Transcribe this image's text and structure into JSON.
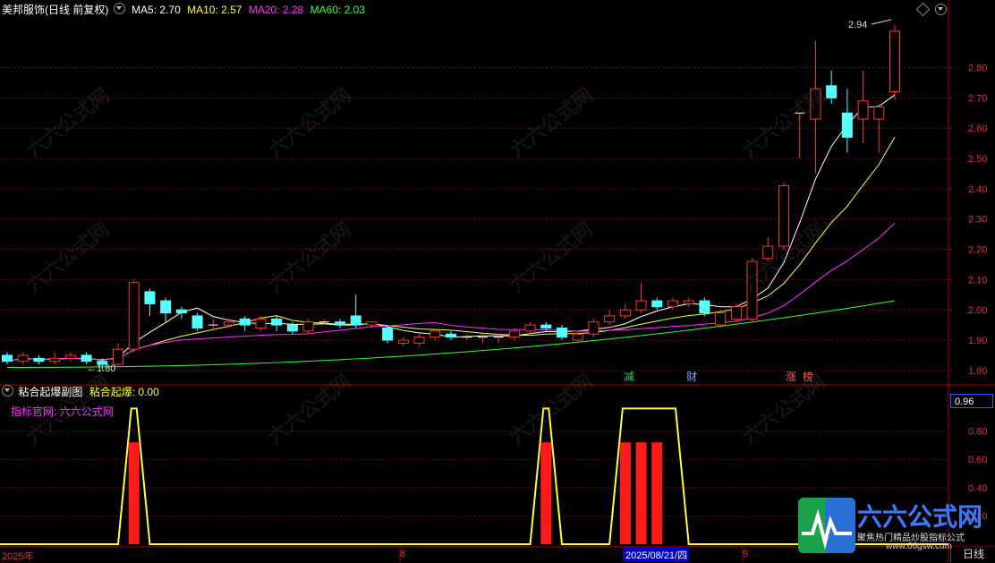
{
  "main_header": {
    "stock_name": "美邦服饰",
    "period": "(日线 前复权)",
    "ma5": {
      "label": "MA5:",
      "value": "2.70",
      "color": "#ffffff"
    },
    "ma10": {
      "label": "MA10:",
      "value": "2.57",
      "color": "#ffff33"
    },
    "ma20": {
      "label": "MA20:",
      "value": "2.28",
      "color": "#ff33ff"
    },
    "ma60": {
      "label": "MA60:",
      "value": "2.03",
      "color": "#33ff33"
    }
  },
  "sub_header": {
    "indicator": "粘合起爆副图",
    "series_label": "粘合起爆:",
    "series_value": "0.00",
    "site_label": "指标官网:",
    "site_value": "六六公式网"
  },
  "price_axis": [
    "2.80",
    "2.70",
    "2.60",
    "2.50",
    "2.40",
    "2.30",
    "2.20",
    "2.10",
    "2.00",
    "1.90",
    "1.80"
  ],
  "sub_axis": [
    "0.96",
    "0.80",
    "0.60",
    "0.40",
    "0.20"
  ],
  "annotations": {
    "high": "2.94",
    "low": "1.80"
  },
  "event_tags": [
    {
      "text": "减",
      "color": "#33cc66"
    },
    {
      "text": "财",
      "color": "#66aaff"
    },
    {
      "text": "涨",
      "color": "#ff5555"
    },
    {
      "text": "榜",
      "color": "#ff5555"
    }
  ],
  "date_axis": {
    "year": "2025年",
    "month8": "8",
    "cursor_date": "2025/08/21/四",
    "month9": "9",
    "period_button": "日线"
  },
  "watermark": {
    "text": "六六公式网",
    "slogan": "聚焦热门精品炒股指标公式",
    "url": "www.66gsw.com"
  },
  "chart_data": {
    "type": "candlestick",
    "ylim": [
      1.77,
      2.97
    ],
    "candles": [
      [
        1.85,
        1.83,
        1.86,
        1.82
      ],
      [
        1.83,
        1.85,
        1.86,
        1.82
      ],
      [
        1.84,
        1.83,
        1.85,
        1.82
      ],
      [
        1.83,
        1.84,
        1.86,
        1.82
      ],
      [
        1.84,
        1.85,
        1.86,
        1.83
      ],
      [
        1.85,
        1.83,
        1.86,
        1.82
      ],
      [
        1.83,
        1.82,
        1.84,
        1.8
      ],
      [
        1.82,
        1.87,
        1.89,
        1.81
      ],
      [
        1.87,
        2.09,
        2.1,
        1.86
      ],
      [
        2.06,
        2.02,
        2.07,
        1.98
      ],
      [
        2.03,
        1.99,
        2.04,
        1.96
      ],
      [
        2.0,
        1.99,
        2.01,
        1.97
      ],
      [
        1.98,
        1.94,
        1.99,
        1.93
      ],
      [
        1.95,
        1.95,
        1.97,
        1.93
      ],
      [
        1.95,
        1.96,
        1.97,
        1.94
      ],
      [
        1.97,
        1.95,
        1.98,
        1.93
      ],
      [
        1.94,
        1.97,
        1.98,
        1.93
      ],
      [
        1.97,
        1.95,
        1.98,
        1.93
      ],
      [
        1.95,
        1.93,
        1.96,
        1.92
      ],
      [
        1.93,
        1.96,
        1.97,
        1.92
      ],
      [
        1.96,
        1.96,
        1.97,
        1.95
      ],
      [
        1.96,
        1.95,
        1.97,
        1.94
      ],
      [
        1.98,
        1.95,
        2.05,
        1.94
      ],
      [
        1.95,
        1.96,
        1.96,
        1.94
      ],
      [
        1.94,
        1.9,
        1.94,
        1.89
      ],
      [
        1.89,
        1.9,
        1.91,
        1.88
      ],
      [
        1.89,
        1.91,
        1.92,
        1.88
      ],
      [
        1.91,
        1.93,
        1.94,
        1.9
      ],
      [
        1.92,
        1.91,
        1.93,
        1.9
      ],
      [
        1.91,
        1.91,
        1.92,
        1.9
      ],
      [
        1.91,
        1.91,
        1.92,
        1.89
      ],
      [
        1.91,
        1.91,
        1.92,
        1.89
      ],
      [
        1.91,
        1.93,
        1.94,
        1.9
      ],
      [
        1.93,
        1.95,
        1.96,
        1.92
      ],
      [
        1.95,
        1.94,
        1.96,
        1.93
      ],
      [
        1.94,
        1.91,
        1.95,
        1.9
      ],
      [
        1.9,
        1.92,
        1.93,
        1.89
      ],
      [
        1.92,
        1.96,
        1.97,
        1.91
      ],
      [
        1.96,
        1.98,
        2.0,
        1.95
      ],
      [
        1.98,
        2.0,
        2.02,
        1.97
      ],
      [
        2.0,
        2.03,
        2.09,
        1.99
      ],
      [
        2.03,
        2.01,
        2.04,
        2.0
      ],
      [
        2.01,
        2.03,
        2.04,
        2.0
      ],
      [
        2.02,
        2.03,
        2.04,
        2.01
      ],
      [
        2.03,
        1.99,
        2.04,
        1.98
      ],
      [
        1.95,
        1.99,
        2.0,
        1.94
      ],
      [
        1.97,
        2.01,
        2.02,
        1.96
      ],
      [
        1.97,
        2.16,
        2.17,
        1.96
      ],
      [
        2.17,
        2.21,
        2.24,
        2.16
      ],
      [
        2.21,
        2.41,
        2.42,
        2.2
      ],
      [
        2.65,
        2.65,
        2.65,
        2.5
      ],
      [
        2.63,
        2.73,
        2.89,
        2.45
      ],
      [
        2.74,
        2.7,
        2.79,
        2.68
      ],
      [
        2.65,
        2.57,
        2.73,
        2.52
      ],
      [
        2.63,
        2.69,
        2.79,
        2.55
      ],
      [
        2.63,
        2.67,
        2.68,
        2.52
      ],
      [
        2.72,
        2.92,
        2.94,
        2.69
      ]
    ],
    "sub_signal": [
      {
        "series": "粘合起爆",
        "peaks_at": [
          8,
          34,
          39,
          40,
          41,
          42
        ],
        "peak_value": 0.96
      },
      {
        "series": "histogram",
        "bars_at": [
          8,
          34,
          39,
          40,
          41
        ],
        "value": 0.72
      }
    ]
  }
}
